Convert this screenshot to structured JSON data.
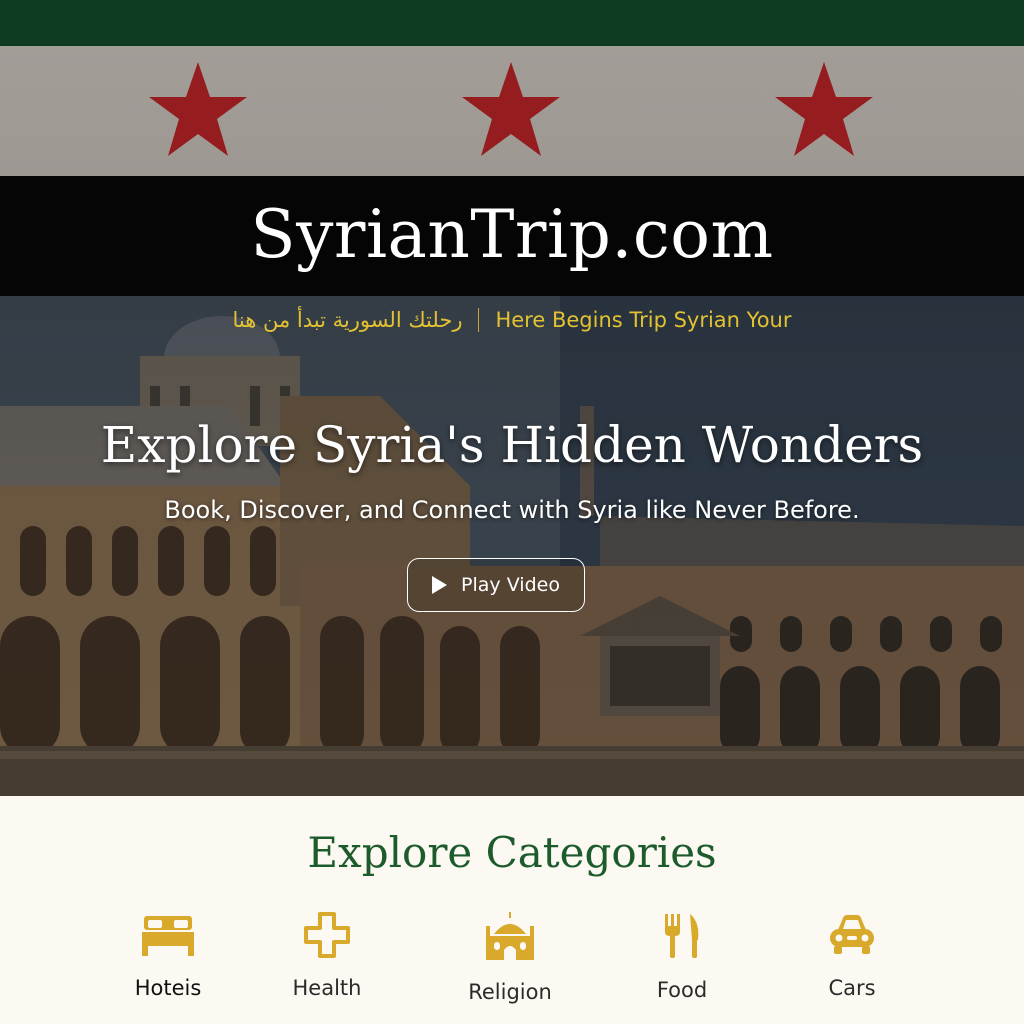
{
  "brand": {
    "name": "SyrianTrip.com"
  },
  "tagline": {
    "arabic": "رحلتك السورية تبدأ من هنا",
    "english": "Here Begins Trip Syrian Your"
  },
  "hero": {
    "title": "Explore Syria's Hidden Wonders",
    "subtitle": "Book, Discover, and Connect with Syria like Never Before.",
    "play_label": "Play Video"
  },
  "categories": {
    "title": "Explore Categories",
    "items": [
      {
        "label": "Hoteis",
        "icon": "bed-icon"
      },
      {
        "label": "Health",
        "icon": "medical-cross-icon"
      },
      {
        "label": "Religion",
        "icon": "mosque-icon"
      },
      {
        "label": "Food",
        "icon": "fork-knife-icon"
      },
      {
        "label": "Cars",
        "icon": "car-icon"
      }
    ]
  },
  "colors": {
    "flag_green": "#0f3b20",
    "flag_white": "#a39d98",
    "flag_black": "#050505",
    "star_red": "#951d1f",
    "accent_gold": "#e3c232",
    "icon_gold": "#d8a92a",
    "category_title": "#1d5a2c"
  }
}
